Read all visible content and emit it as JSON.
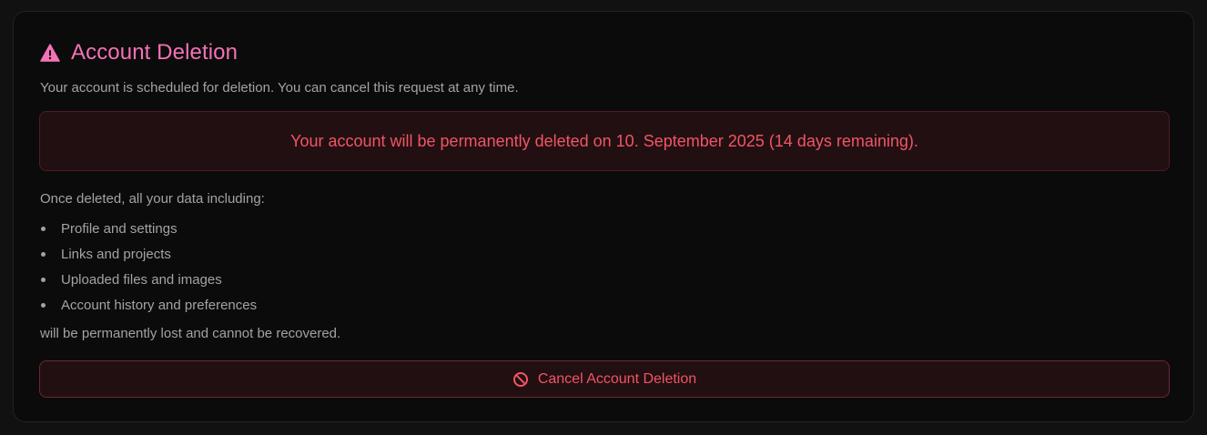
{
  "section": {
    "title": "Account Deletion",
    "title_icon": "warning-triangle-icon",
    "subtitle": "Your account is scheduled for deletion. You can cancel this request at any time."
  },
  "alert": {
    "message": "Your account will be permanently deleted on 10. September 2025 (14 days remaining)."
  },
  "details": {
    "intro": "Once deleted, all your data including:",
    "items": [
      "Profile and settings",
      "Links and projects",
      "Uploaded files and images",
      "Account history and preferences"
    ],
    "outro": "will be permanently lost and cannot be recovered."
  },
  "cancel_button": {
    "label": "Cancel Account Deletion",
    "icon": "ban-icon"
  },
  "colors": {
    "page_background": "#111111",
    "card_background": "#0b0b0b",
    "accent_pink": "#f472b6",
    "danger_red": "#f05565",
    "danger_background": "#220f11",
    "muted_text": "#a3a3a3"
  }
}
